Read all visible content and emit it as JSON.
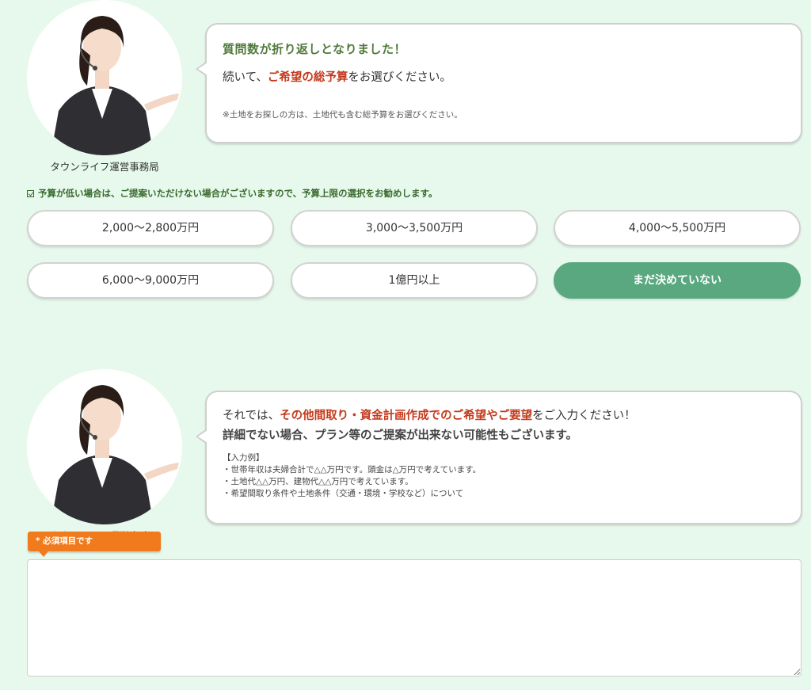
{
  "q1": {
    "agent_name": "タウンライフ運営事務局",
    "title": "質問数が折り返しとなりました！",
    "line_prefix": "続いて、",
    "line_emph": "ご希望の総予算",
    "line_suffix": "をお選びください。",
    "note": "※土地をお探しの方は、土地代も含む総予算をお選びください。"
  },
  "hint": "予算が低い場合は、ご提案いただけない場合がございますので、予算上限の選択をお勧めします。",
  "options": [
    "2,000〜2,800万円",
    "3,000〜3,500万円",
    "4,000〜5,500万円",
    "6,000〜9,000万円",
    "1億円以上",
    "まだ決めていない"
  ],
  "selected_option": "まだ決めていない",
  "q2": {
    "agent_name": "タウンライフ運営事務局",
    "l1_prefix": "それでは、",
    "l1_emph": "その他間取り・資金計画作成でのご希望やご要望",
    "l1_suffix": "をご入力ください！",
    "l2": "詳細でない場合、プラン等のご提案が出来ない可能性もございます。",
    "example_title": "【入力例】",
    "examples": [
      "・世帯年収は夫婦合計で△△万円です。頭金は△万円で考えています。",
      "・土地代△△万円、建物代△△万円で考えています。",
      "・希望間取り条件や土地条件（交通・環境・学校など）について"
    ]
  },
  "required_label": "* 必須項目です",
  "textarea_value": "",
  "colors": {
    "background": "#e6f9ec",
    "accent_green": "#5aa880",
    "emphasis_red": "#c43a1c",
    "required_orange": "#f07a1c"
  }
}
